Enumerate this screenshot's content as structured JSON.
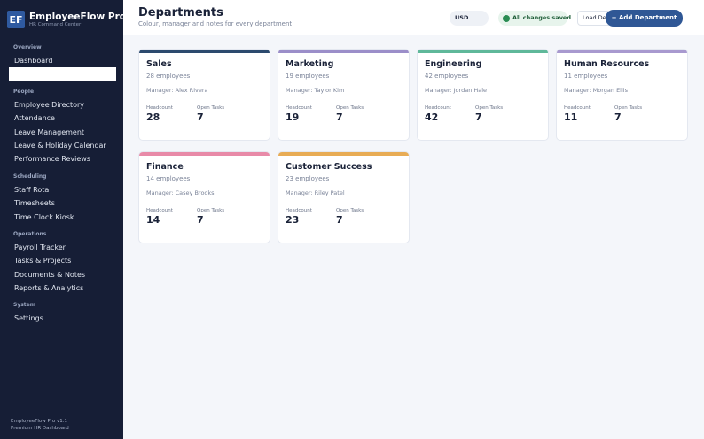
{
  "brand": {
    "logo": "EF",
    "title": "EmployeeFlow Pro",
    "subtitle": "HR Command Center"
  },
  "sidebar": {
    "sections": [
      {
        "title": "Overview",
        "items": [
          {
            "label": "Dashboard"
          },
          {
            "label": ""
          }
        ]
      },
      {
        "title": "People",
        "items": [
          {
            "label": "Employee Directory"
          },
          {
            "label": "Attendance"
          },
          {
            "label": "Leave Management"
          },
          {
            "label": "Leave & Holiday Calendar"
          },
          {
            "label": "Performance Reviews"
          }
        ]
      },
      {
        "title": "Scheduling",
        "items": [
          {
            "label": "Staff Rota"
          },
          {
            "label": "Timesheets"
          },
          {
            "label": "Time Clock Kiosk"
          }
        ]
      },
      {
        "title": "Operations",
        "items": [
          {
            "label": "Payroll Tracker"
          },
          {
            "label": "Tasks & Projects"
          },
          {
            "label": "Documents & Notes"
          },
          {
            "label": "Reports & Analytics"
          }
        ]
      },
      {
        "title": "System",
        "items": [
          {
            "label": "Settings"
          }
        ]
      }
    ],
    "footer": {
      "version": "EmployeeFlow Pro v1.1",
      "tagline": "Premium HR Dashboard"
    }
  },
  "header": {
    "title": "Departments",
    "subtitle": "Colour, manager and notes for every department",
    "currency": "USD",
    "save_status": "All changes saved",
    "load_label": "Load Demo",
    "add_label": "+ Add Department"
  },
  "stat_labels": {
    "headcount": "Headcount",
    "tasks": "Open Tasks"
  },
  "departments": [
    {
      "name": "Sales",
      "employees": "28 employees",
      "manager": "Manager: Alex Rivera",
      "headcount": "28",
      "tasks": "7",
      "color": "#2c4a6e"
    },
    {
      "name": "Marketing",
      "employees": "19 employees",
      "manager": "Manager: Taylor Kim",
      "headcount": "19",
      "tasks": "7",
      "color": "#9b8ec9"
    },
    {
      "name": "Engineering",
      "employees": "42 employees",
      "manager": "Manager: Jordan Hale",
      "headcount": "42",
      "tasks": "7",
      "color": "#5fb89a"
    },
    {
      "name": "Human Resources",
      "employees": "11 employees",
      "manager": "Manager: Morgan Ellis",
      "headcount": "11",
      "tasks": "7",
      "color": "#a899cf"
    },
    {
      "name": "Finance",
      "employees": "14 employees",
      "manager": "Manager: Casey Brooks",
      "headcount": "14",
      "tasks": "7",
      "color": "#e88aa8"
    },
    {
      "name": "Customer Success",
      "employees": "23 employees",
      "manager": "Manager: Riley Patel",
      "headcount": "23",
      "tasks": "7",
      "color": "#e8ac55"
    }
  ]
}
